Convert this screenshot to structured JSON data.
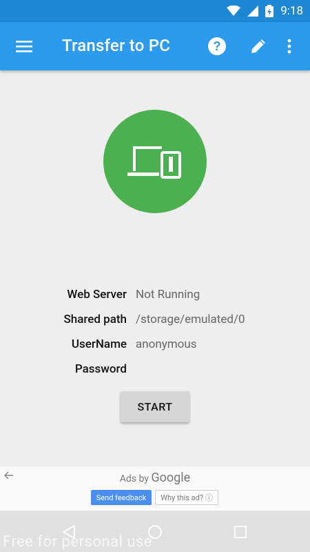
{
  "status_bar": {
    "time": "9:18"
  },
  "app_bar": {
    "title": "Transfer to PC",
    "menu_icon": "hamburger-menu-icon",
    "help_icon": "help-circle-icon",
    "edit_icon": "pencil-icon",
    "overflow_icon": "more-vert-icon"
  },
  "hero": {
    "icon": "laptop-phone-icon",
    "color": "#4caf50"
  },
  "info": [
    {
      "label": "Web Server",
      "value": "Not Running"
    },
    {
      "label": "Shared path",
      "value": "/storage/emulated/0"
    },
    {
      "label": "UserName",
      "value": "anonymous"
    },
    {
      "label": "Password",
      "value": ""
    }
  ],
  "start_button": {
    "label": "START"
  },
  "ad": {
    "ads_by": "Ads by",
    "brand": "Google",
    "send_feedback": "Send feedback",
    "why_this_ad": "Why this ad? ⓘ"
  },
  "watermark": "Free for personal use",
  "colors": {
    "primary": "#2d9bed",
    "status_bar": "#1e88d4",
    "accent_green": "#4caf50"
  }
}
